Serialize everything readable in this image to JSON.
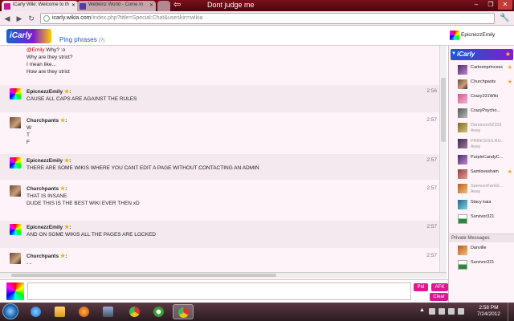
{
  "browser": {
    "tabs": [
      {
        "title": "iCarly Wiki: Welcome to th",
        "active": true
      },
      {
        "title": "Webkinz World - Come In",
        "active": false
      }
    ],
    "note_arrow": "⇦",
    "note_text": "Dont judge me",
    "url_host": "icarly.wikia.com",
    "url_rest": "/index.php?title=Special:Chat&useskin=wikia"
  },
  "header": {
    "logo_text": "iCarly",
    "ping_label": "Ping phrases",
    "ping_count": "(?)",
    "current_user": "EpicnezzEmily"
  },
  "messages": [
    {
      "continuation": true,
      "mention": "@Emily",
      "lines": [
        "Why? :o",
        "Why are they strict?",
        "I mean like...",
        "How are they strict"
      ]
    },
    {
      "user": "EpicnezzEmily",
      "star": "★",
      "time": "2:56",
      "lines": [
        "CAUSE ALL CAPS ARE AGAINST THE RULES"
      ],
      "avatar": "rainbow"
    },
    {
      "user": "Churchpants",
      "star": "★",
      "time": "2:57",
      "lines": [
        "W",
        "T",
        "F"
      ],
      "avatar": "brown"
    },
    {
      "user": "EpicnezzEmily",
      "star": "★",
      "time": "2:57",
      "lines": [
        "THERE ARE SOME WIKIS WHERE YOU CANT EDIT A PAGE WITHOUT CONTACTING AN ADMIN"
      ],
      "avatar": "rainbow"
    },
    {
      "user": "Churchpants",
      "star": "★",
      "time": "2:57",
      "lines": [
        "THAT IS INSANE",
        "DUDE THIS IS THE BEST WIKI EVER THEN xD"
      ],
      "avatar": "brown"
    },
    {
      "user": "EpicnezzEmily",
      "star": "★",
      "time": "2:57",
      "lines": [
        "AND ON SOME WIKIS ALL THE PAGES ARE LOCKED"
      ],
      "avatar": "rainbow"
    },
    {
      "user": "Churchpants",
      "star": "★",
      "time": "2:57",
      "lines": [
        "- -"
      ],
      "avatar": "brown"
    }
  ],
  "composer": {
    "pm_label": "PM",
    "afk_label": "AFK",
    "clear_label": "Clear"
  },
  "sidebar": {
    "users": [
      {
        "name": "Cartoonprincess",
        "star": true,
        "away": false,
        "avatar": "purple"
      },
      {
        "name": "Churchpants",
        "star": true,
        "away": false,
        "avatar": "brown"
      },
      {
        "name": "Crazy101Wiki",
        "star": false,
        "away": false,
        "avatar": "pink"
      },
      {
        "name": "CrazyPsycho...",
        "star": false,
        "away": false,
        "avatar": "grey"
      },
      {
        "name": "Dennison52102",
        "star": false,
        "away": true,
        "status": "Away",
        "avatar": "olive"
      },
      {
        "name": "PRINCESS.RU...",
        "star": false,
        "away": true,
        "status": "Away",
        "avatar": "dark"
      },
      {
        "name": "PurpleCandyC...",
        "star": false,
        "away": false,
        "avatar": "purple"
      },
      {
        "name": "Samlovesham",
        "star": true,
        "away": false,
        "avatar": "rose"
      },
      {
        "name": "SpencerFanGi...",
        "star": false,
        "away": true,
        "status": "Away",
        "avatar": "orange"
      },
      {
        "name": "Stacy kaia",
        "star": false,
        "away": false,
        "avatar": "cyan"
      },
      {
        "name": "Survivor321",
        "star": false,
        "away": false,
        "avatar": "green"
      }
    ],
    "private_messages_label": "Private Messages",
    "private_messages": [
      {
        "name": "Danville",
        "avatar": "orange"
      },
      {
        "name": "Survivor321",
        "avatar": "green"
      }
    ]
  },
  "taskbar": {
    "time": "2:58 PM",
    "date": "7/24/2012"
  }
}
